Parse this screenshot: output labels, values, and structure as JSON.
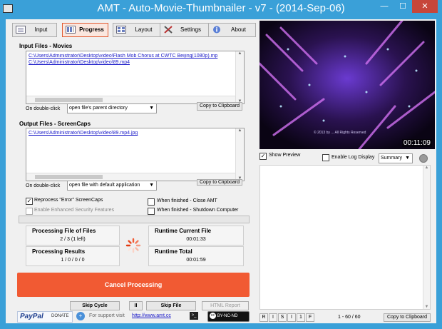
{
  "window": {
    "title": "AMT - Auto-Movie-Thumbnailer - v7 - (2014-Sep-06)",
    "minimize": "—",
    "maximize": "☐",
    "close": "✕"
  },
  "tabs": [
    {
      "label": "Input",
      "icon": "list-icon"
    },
    {
      "label": "Progress",
      "icon": "progress-icon"
    },
    {
      "label": "Layout",
      "icon": "layout-icon"
    },
    {
      "label": "Settings",
      "icon": "tools-icon"
    },
    {
      "label": "About",
      "icon": "info-icon"
    }
  ],
  "input_files": {
    "label": "Input Files - Movies",
    "files": [
      "C:\\Users\\Administrator\\Desktop\\video\\Flash Mob Chorus at CWTC Beijing(1080p).mp",
      "C:\\Users\\Administrator\\Desktop\\video\\89.mp4"
    ],
    "dbl_click_label": "On double-click",
    "dbl_click_value": "open file's parent directory",
    "copy_button": "Copy to Clipboard"
  },
  "output_files": {
    "label": "Output Files - ScreenCaps",
    "files": [
      "C:\\Users\\Administrator\\Desktop\\video\\89.mp4.jpg"
    ],
    "dbl_click_label": "On double-click",
    "dbl_click_value": "open file with default application",
    "copy_button": "Copy to Clipboard"
  },
  "options": {
    "reprocess": {
      "label": "Reprocess \"Error\" ScreenCaps",
      "checked": true
    },
    "security": {
      "label": "Enable Enhanced Security Features",
      "checked": false
    },
    "close_amt": {
      "label": "When finished - Close AMT",
      "checked": false
    },
    "shutdown": {
      "label": "When finished - Shutdown Computer",
      "checked": false
    }
  },
  "stats": {
    "processing_file_label": "Processing File of Files",
    "processing_file_value": "2 / 3  (1 left)",
    "runtime_current_label": "Runtime Current File",
    "runtime_current_value": "00:01:33",
    "processing_results_label": "Processing Results",
    "processing_results_value": "1 / 0 / 0 / 0",
    "runtime_total_label": "Runtime Total",
    "runtime_total_value": "00:01:59"
  },
  "actions": {
    "cancel": "Cancel Processing",
    "skip_cycle": "Skip Cycle",
    "pause": "II",
    "skip_file": "Skip File",
    "html_report": "HTML Report"
  },
  "footer": {
    "paypal": "PayPal",
    "donate": "DONATE",
    "support_text": "For support visit",
    "support_link": "http://www.amt.cc",
    "license": "BY-NC-ND"
  },
  "preview": {
    "timestamp": "00:11:09",
    "watermark": "© 2013 by ... All Rights Reserved",
    "show_preview": {
      "label": "Show Preview",
      "checked": true
    },
    "enable_log": {
      "label": "Enable Log Display",
      "checked": false
    },
    "log_mode": "Summary",
    "log_buttons": [
      "R",
      "I",
      "S",
      "I",
      "1",
      "F"
    ],
    "count": "1 - 60 / 60",
    "copy_button": "Copy to Clipboard"
  },
  "colors": {
    "accent": "#f15a33",
    "titlebar": "#3aa0d8",
    "link": "#1a1ac8"
  }
}
